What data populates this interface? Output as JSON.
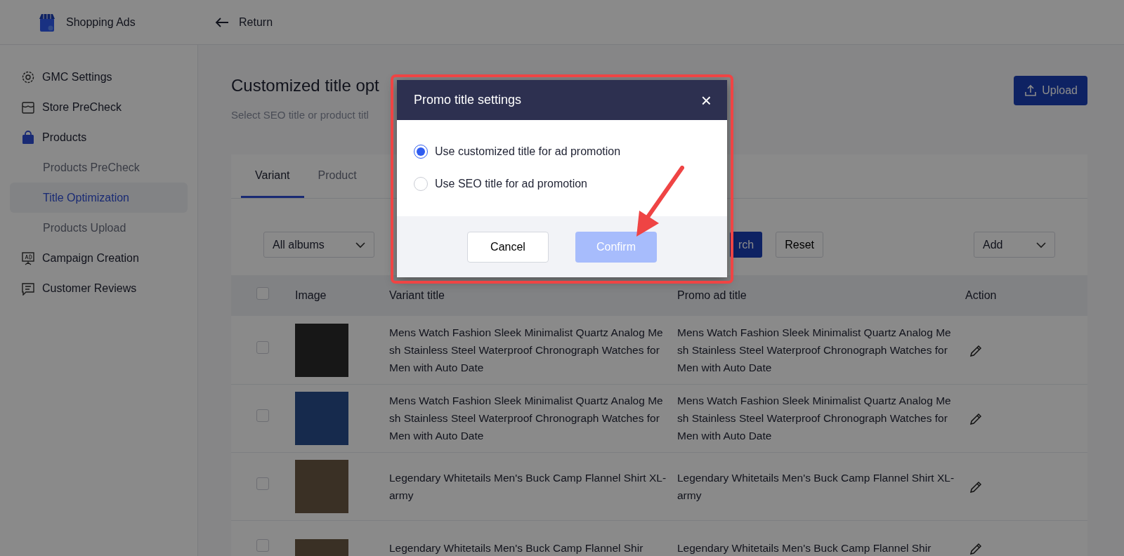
{
  "app": {
    "name": "Shopping Ads"
  },
  "header": {
    "back_label": "Return"
  },
  "sidebar": {
    "items": [
      {
        "label": "GMC Settings",
        "selected": false
      },
      {
        "label": "Store PreCheck",
        "selected": false
      },
      {
        "label": "Products",
        "selected": false,
        "children": [
          {
            "label": "Products PreCheck",
            "selected": false
          },
          {
            "label": "Title Optimization",
            "selected": true
          },
          {
            "label": "Products Upload",
            "selected": false
          }
        ]
      },
      {
        "label": "Campaign Creation",
        "selected": false
      },
      {
        "label": "Customer Reviews",
        "selected": false
      }
    ]
  },
  "page": {
    "title": "Customized title opt",
    "subtitle": "Select SEO title or product titl",
    "upload_button": "Upload"
  },
  "tabs": [
    {
      "label": "Variant",
      "selected": true
    },
    {
      "label": "Product",
      "selected": false
    }
  ],
  "filters": {
    "album_select": "All albums",
    "search_button": "rch",
    "reset_button": "Reset",
    "add_select": "Add"
  },
  "table": {
    "select_all_checked": false,
    "columns": [
      "Image",
      "Variant title",
      "Promo ad title",
      "Action"
    ],
    "rows": [
      {
        "checked": false,
        "variant_title": "Mens Watch Fashion Sleek Minimalist Quartz Analog Mesh Stainless Steel Waterproof Chronograph Watches for Men with Auto Date",
        "promo_title": "Mens Watch Fashion Sleek Minimalist Quartz Analog Mesh Stainless Steel Waterproof Chronograph Watches for Men with Auto Date"
      },
      {
        "checked": false,
        "variant_title": "Mens Watch Fashion Sleek Minimalist Quartz Analog Mesh Stainless Steel Waterproof Chronograph Watches for Men with Auto Date",
        "promo_title": "Mens Watch Fashion Sleek Minimalist Quartz Analog Mesh Stainless Steel Waterproof Chronograph Watches for Men with Auto Date"
      },
      {
        "checked": false,
        "variant_title": "Legendary Whitetails Men's Buck Camp Flannel Shirt XL-army",
        "promo_title": "Legendary Whitetails Men's Buck Camp Flannel Shirt XL-army"
      },
      {
        "checked": false,
        "variant_title": "Legendary Whitetails Men's Buck Camp Flannel Shir",
        "promo_title": "Legendary Whitetails Men's Buck Camp Flannel Shir"
      }
    ]
  },
  "modal": {
    "title": "Promo title settings",
    "close": "×",
    "options": [
      {
        "label": "Use customized title for ad promotion",
        "selected": true
      },
      {
        "label": "Use SEO title for ad promotion",
        "selected": false
      }
    ],
    "cancel_button": "Cancel",
    "confirm_button": {
      "label": "Confirm",
      "disabled": true
    }
  }
}
